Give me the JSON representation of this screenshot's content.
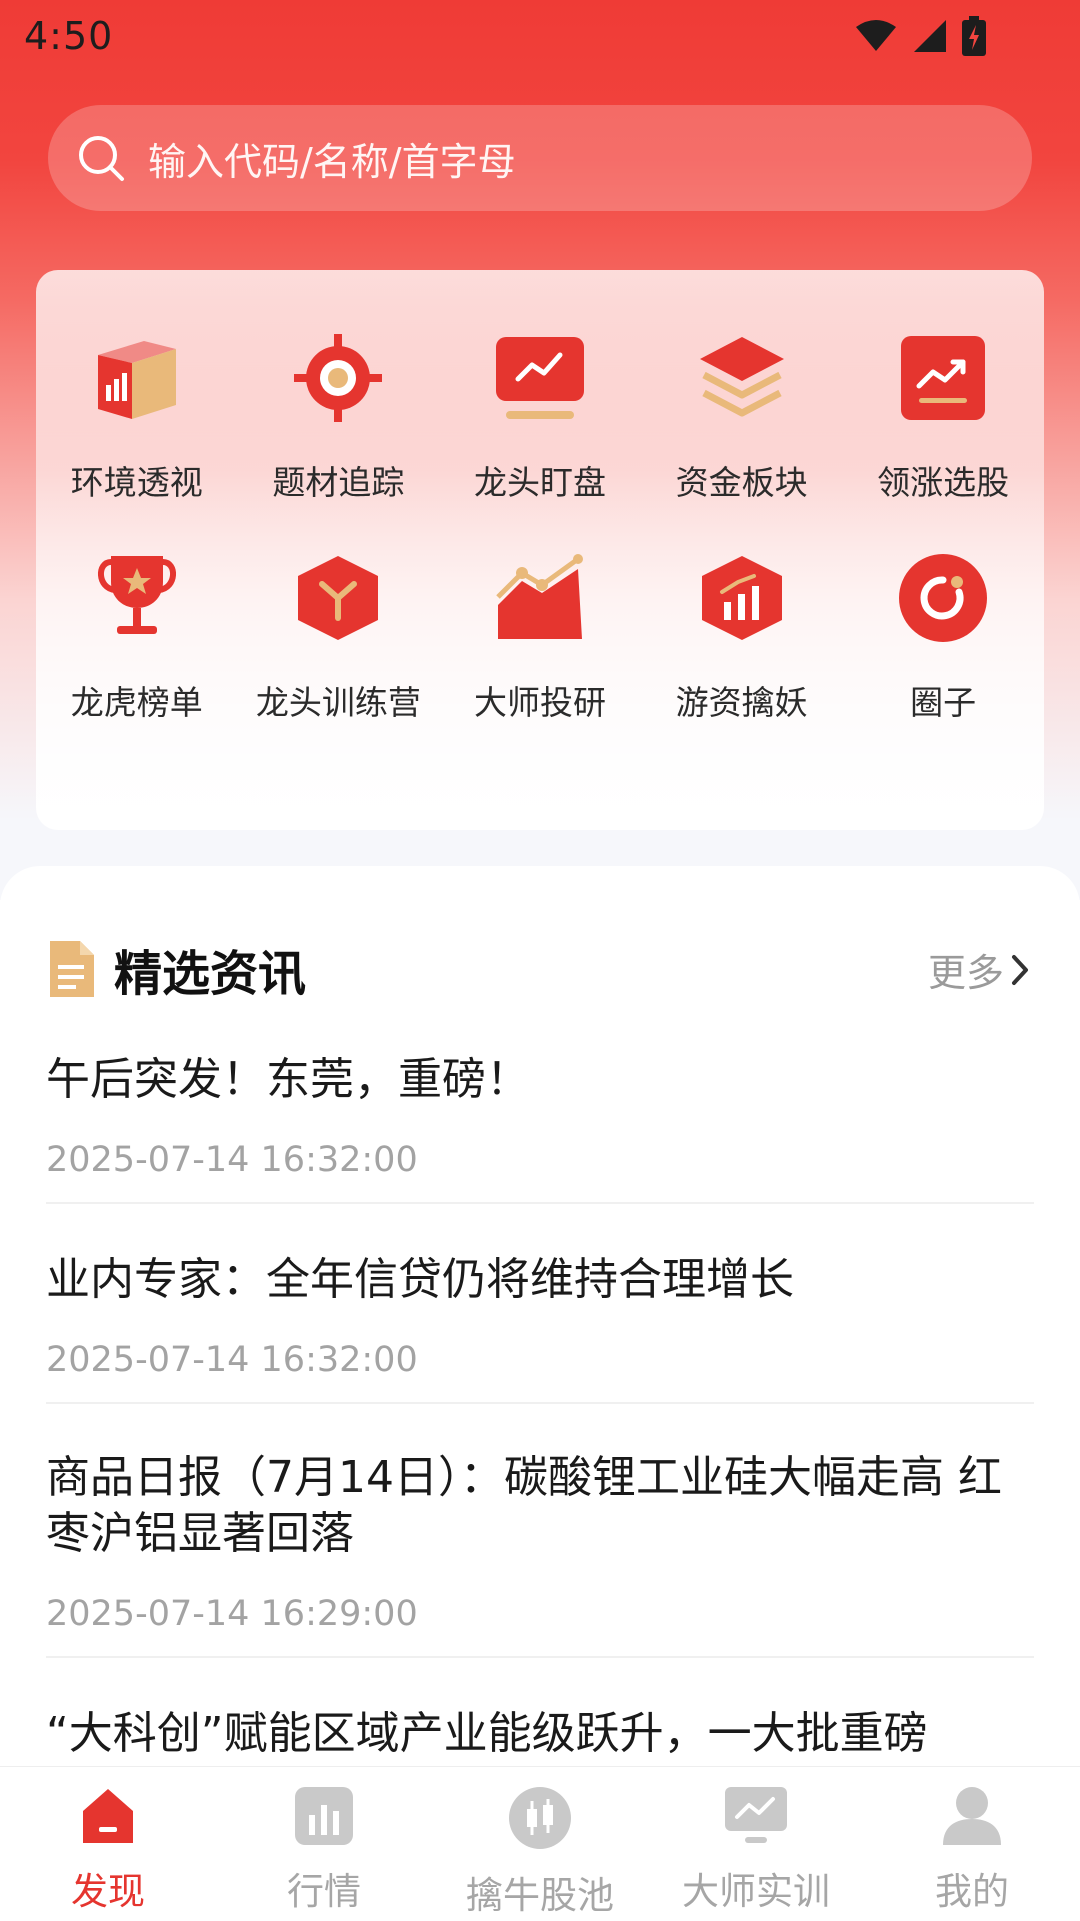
{
  "status": {
    "time": "4:50"
  },
  "search": {
    "placeholder": "输入代码/名称/首字母"
  },
  "features": [
    {
      "label": "环境透视",
      "icon": "cube-chart-icon"
    },
    {
      "label": "题材追踪",
      "icon": "target-icon"
    },
    {
      "label": "龙头盯盘",
      "icon": "monitor-chart-icon"
    },
    {
      "label": "资金板块",
      "icon": "layers-icon"
    },
    {
      "label": "领涨选股",
      "icon": "trend-up-icon"
    },
    {
      "label": "龙虎榜单",
      "icon": "trophy-icon"
    },
    {
      "label": "龙头训练营",
      "icon": "hexagon-branch-icon"
    },
    {
      "label": "大师投研",
      "icon": "area-chart-icon"
    },
    {
      "label": "游资擒妖",
      "icon": "hexagon-bar-icon"
    },
    {
      "label": "圈子",
      "icon": "circle-refresh-icon"
    }
  ],
  "news": {
    "title": "精选资讯",
    "more": "更多",
    "items": [
      {
        "title": "午后突发！东莞，重磅！",
        "date": "2025-07-14 16:32:00"
      },
      {
        "title": "业内专家：全年信贷仍将维持合理增长",
        "date": "2025-07-14 16:32:00"
      },
      {
        "title": "商品日报（7月14日）：碳酸锂工业硅大幅走高 红枣沪铝显著回落",
        "date": "2025-07-14 16:29:00"
      },
      {
        "title": "“大科创”赋能区域产业能级跃升，一大批重磅",
        "date": ""
      }
    ]
  },
  "tabs": [
    {
      "label": "发现",
      "active": true
    },
    {
      "label": "行情",
      "active": false
    },
    {
      "label": "擒牛股池",
      "active": false
    },
    {
      "label": "大师实训",
      "active": false
    },
    {
      "label": "我的",
      "active": false
    }
  ],
  "colors": {
    "accent": "#e5352f",
    "gold": "#e9b97a",
    "inactive": "#c9c9c9"
  }
}
